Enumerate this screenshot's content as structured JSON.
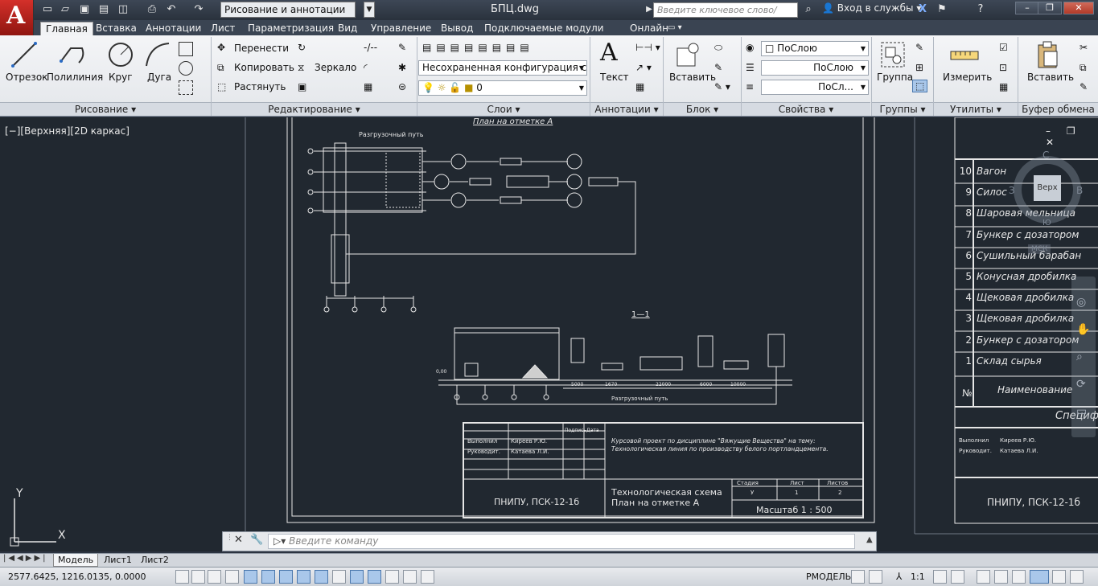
{
  "titlebar": {
    "workspace": "Рисование и аннотации",
    "document_title": "БПЦ.dwg",
    "search_placeholder": "Введите ключевое слово/фразу",
    "login": "Вход в службы"
  },
  "ribbon_tabs": [
    "Главная",
    "Вставка",
    "Аннотации",
    "Лист",
    "Параметризация",
    "Вид",
    "Управление",
    "Вывод",
    "Подключаемые модули",
    "Онлайн"
  ],
  "ribbon": {
    "draw": {
      "line": "Отрезок",
      "polyline": "Полилиния",
      "circle": "Круг",
      "arc": "Дуга",
      "title": "Рисование"
    },
    "modify": {
      "move": "Перенести",
      "copy": "Копировать",
      "stretch": "Растянуть",
      "mirror": "Зеркало",
      "title": "Редактирование"
    },
    "layers": {
      "state": "Несохраненная конфигурация сло",
      "current_layer": "0",
      "title": "Слои"
    },
    "annotation": {
      "text": "Текст",
      "title": "Аннотации"
    },
    "block": {
      "insert": "Вставить",
      "title": "Блок"
    },
    "properties": {
      "color": "ПоСлою",
      "linetype": "ПоСлою",
      "lineweight": "ПоСл...",
      "title": "Свойства"
    },
    "groups": {
      "group": "Группа",
      "title": "Группы"
    },
    "utilities": {
      "measure": "Измерить",
      "title": "Утилиты"
    },
    "clipboard": {
      "paste": "Вставить",
      "title": "Буфер обмена"
    }
  },
  "viewport_label": "[−][Верхняя][2D каркас]",
  "drawing": {
    "sheet_header": "План на отметке А",
    "section_label": "1—1",
    "rail_label_top": "Разгрузочный путь",
    "rail_label_bottom": "Разгрузочный путь",
    "level": "0,00",
    "dims": [
      "5000",
      "1670",
      "22000",
      "6000",
      "10000"
    ],
    "course_text": "Курсовой проект по дисциплине \"Вяжущие Вещества\" на тему: Технологическая линия по производству белого портландцемента.",
    "org": "ПНИПУ, ПСК-12-1б",
    "scheme_title": "Технологическая схема",
    "scheme_sub": "План на отметке А",
    "stage_head": "Стадия",
    "sheet_head": "Лист",
    "sheets_head": "Листов",
    "stage": "У",
    "sheet": "1",
    "sheets": "2",
    "scale": "Масштаб 1 : 500",
    "roles": [
      "Выполнил",
      "Руководит."
    ],
    "names": [
      "Киреев Р.Ю.",
      "Катаева Л.И."
    ],
    "sign_head": "Подпись",
    "date_head": "Дата",
    "spec_items": [
      {
        "n": "10",
        "name": "Вагон"
      },
      {
        "n": "9",
        "name": "Силос"
      },
      {
        "n": "8",
        "name": "Шаровая мельница"
      },
      {
        "n": "7",
        "name": "Бункер с дозатором"
      },
      {
        "n": "6",
        "name": "Сушильный барабан"
      },
      {
        "n": "5",
        "name": "Конусная дробилка"
      },
      {
        "n": "4",
        "name": "Щековая дробилка"
      },
      {
        "n": "3",
        "name": "Щековая дробилка"
      },
      {
        "n": "2",
        "name": "Бункер с дозатором"
      },
      {
        "n": "1",
        "name": "Склад сырья"
      }
    ],
    "spec_num_head": "№",
    "spec_name_head": "Наименование",
    "spec_title": "Специф",
    "right_roles": [
      "Выполнил",
      "Руководит."
    ],
    "right_names": [
      "Киреев Р.Ю.",
      "Катаева Л.И."
    ],
    "right_org": "ПНИПУ, ПСК-12-1б"
  },
  "viewcube": {
    "top_face": "Верх",
    "north": "С",
    "west": "З",
    "east": "В",
    "south": "Ю",
    "ucs": "МСК"
  },
  "command": {
    "placeholder": "Введите команду"
  },
  "layout_tabs": [
    "Модель",
    "Лист1",
    "Лист2"
  ],
  "status": {
    "coords": "2577.6425, 1216.0135, 0.0000",
    "model": "РМОДЕЛЬ",
    "scale": "1:1"
  }
}
